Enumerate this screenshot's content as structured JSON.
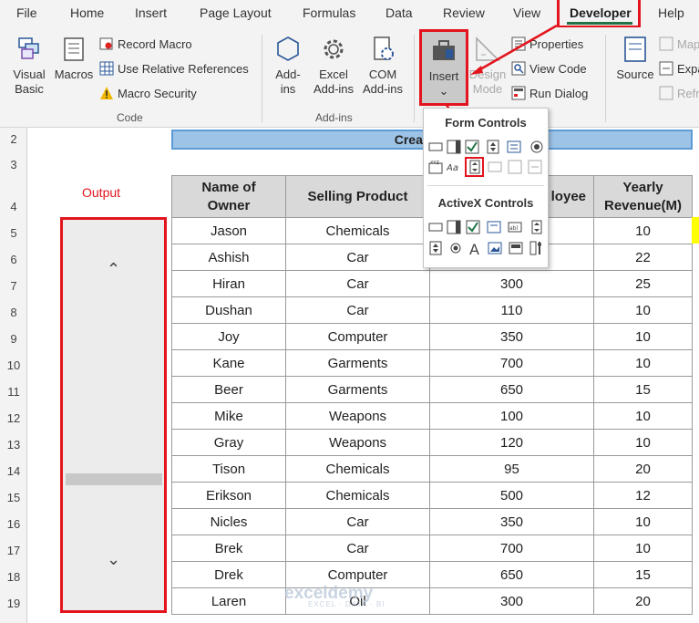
{
  "ribbon_tabs": [
    "File",
    "Home",
    "Insert",
    "Page Layout",
    "Formulas",
    "Data",
    "Review",
    "View",
    "Developer",
    "Help"
  ],
  "code_group": {
    "label": "Code",
    "visual_basic": "Visual Basic",
    "visual_basic_l1": "Visual",
    "visual_basic_l2": "Basic",
    "macros": "Macros",
    "record_macro": "Record Macro",
    "use_relative": "Use Relative References",
    "macro_security": "Macro Security"
  },
  "addins_group": {
    "label": "Add-ins",
    "addins_l1": "Add-",
    "addins_l2": "ins",
    "excel_l1": "Excel",
    "excel_l2": "Add-ins",
    "com_l1": "COM",
    "com_l2": "Add-ins"
  },
  "controls_group": {
    "insert": "Insert",
    "design_l1": "Design",
    "design_l2": "Mode",
    "properties": "Properties",
    "view_code": "View Code",
    "run_dialog": "Run Dialog"
  },
  "xml_group": {
    "source": "Source",
    "map": "Map",
    "expa": "Expa",
    "refr": "Refr"
  },
  "menu": {
    "form_controls": "Form Controls",
    "activex_controls": "ActiveX Controls"
  },
  "sheet": {
    "title": "Creating Ver",
    "output_label": "Output",
    "row_numbers": [
      "2",
      "3",
      "4",
      "5",
      "6",
      "7",
      "8",
      "9",
      "10",
      "11",
      "12",
      "13",
      "14",
      "15",
      "16",
      "17",
      "18",
      "19"
    ],
    "headers": [
      "Name of Owner",
      "Selling Product",
      "loyee",
      "Yearly Revenue(M)"
    ],
    "header_l1": [
      "Name of",
      "Selling Product",
      "loyee",
      "Yearly"
    ],
    "header_l2": [
      "Owner",
      "",
      "",
      "Revenue(M)"
    ],
    "rows": [
      [
        "Jason",
        "Chemicals",
        "",
        "10"
      ],
      [
        "Ashish",
        "Car",
        "",
        "22"
      ],
      [
        "Hiran",
        "Car",
        "300",
        "25"
      ],
      [
        "Dushan",
        "Car",
        "110",
        "10"
      ],
      [
        "Joy",
        "Computer",
        "350",
        "10"
      ],
      [
        "Kane",
        "Garments",
        "700",
        "10"
      ],
      [
        "Beer",
        "Garments",
        "650",
        "15"
      ],
      [
        "Mike",
        "Weapons",
        "100",
        "10"
      ],
      [
        "Gray",
        "Weapons",
        "120",
        "10"
      ],
      [
        "Tison",
        "Chemicals",
        "95",
        "20"
      ],
      [
        "Erikson",
        "Chemicals",
        "500",
        "12"
      ],
      [
        "Nicles",
        "Car",
        "350",
        "10"
      ],
      [
        "Brek",
        "Car",
        "700",
        "10"
      ],
      [
        "Drek",
        "Computer",
        "650",
        "15"
      ],
      [
        "Laren",
        "Oil",
        "300",
        "20"
      ]
    ]
  },
  "scrollbar": {
    "up_glyph": "⌃",
    "down_glyph": "⌄"
  },
  "watermark": {
    "name": "exceldemy",
    "tagline": "EXCEL · DATA · BI"
  },
  "colors": {
    "accent": "#217346",
    "highlight": "#e3141d",
    "title_fill": "#9dc3e6"
  }
}
